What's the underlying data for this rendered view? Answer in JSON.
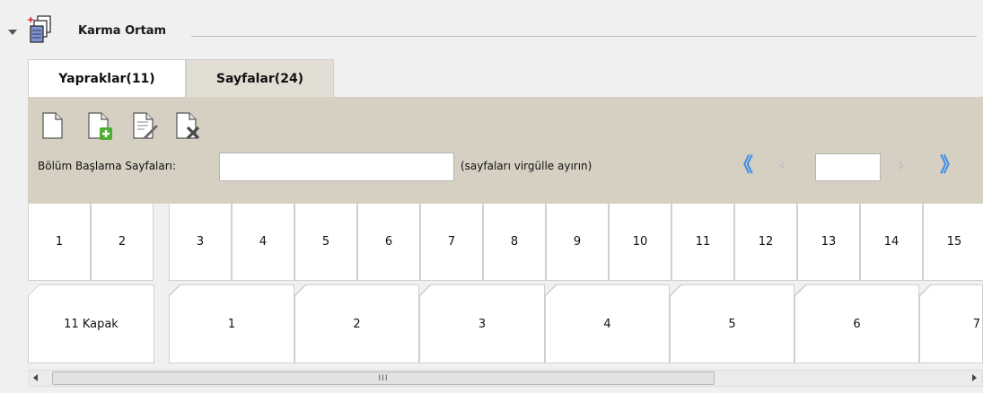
{
  "section": {
    "title": "Karma Ortam",
    "icon": "mixed-media-icon"
  },
  "tabs": [
    {
      "label": "Yapraklar(11)",
      "active": false
    },
    {
      "label": "Sayfalar(24)",
      "active": true
    }
  ],
  "toolbar": {
    "icons": [
      "new-page-icon",
      "insert-page-icon",
      "edit-page-icon",
      "delete-page-icon"
    ],
    "start_pages_label": "Bölüm Başlama Sayfaları:",
    "start_pages_value": "",
    "hint": "(sayfaları virgülle ayırın)",
    "page_value": "",
    "nav_first": "《",
    "nav_prev": "‹",
    "nav_next": "›",
    "nav_last": "》"
  },
  "page_row": [
    "1",
    "2",
    "3",
    "4",
    "5",
    "6",
    "7",
    "8",
    "9",
    "10",
    "11",
    "12",
    "13",
    "14",
    "15"
  ],
  "sheet_row": [
    "11 Kapak",
    "1",
    "2",
    "3",
    "4",
    "5",
    "6",
    "7"
  ],
  "scrollbar": {
    "thumb_glyph": "III"
  },
  "colors": {
    "panel_bg": "#d6d0c3",
    "nav_active": "#3a8fe8",
    "nav_disabled": "#c3c3c3"
  }
}
